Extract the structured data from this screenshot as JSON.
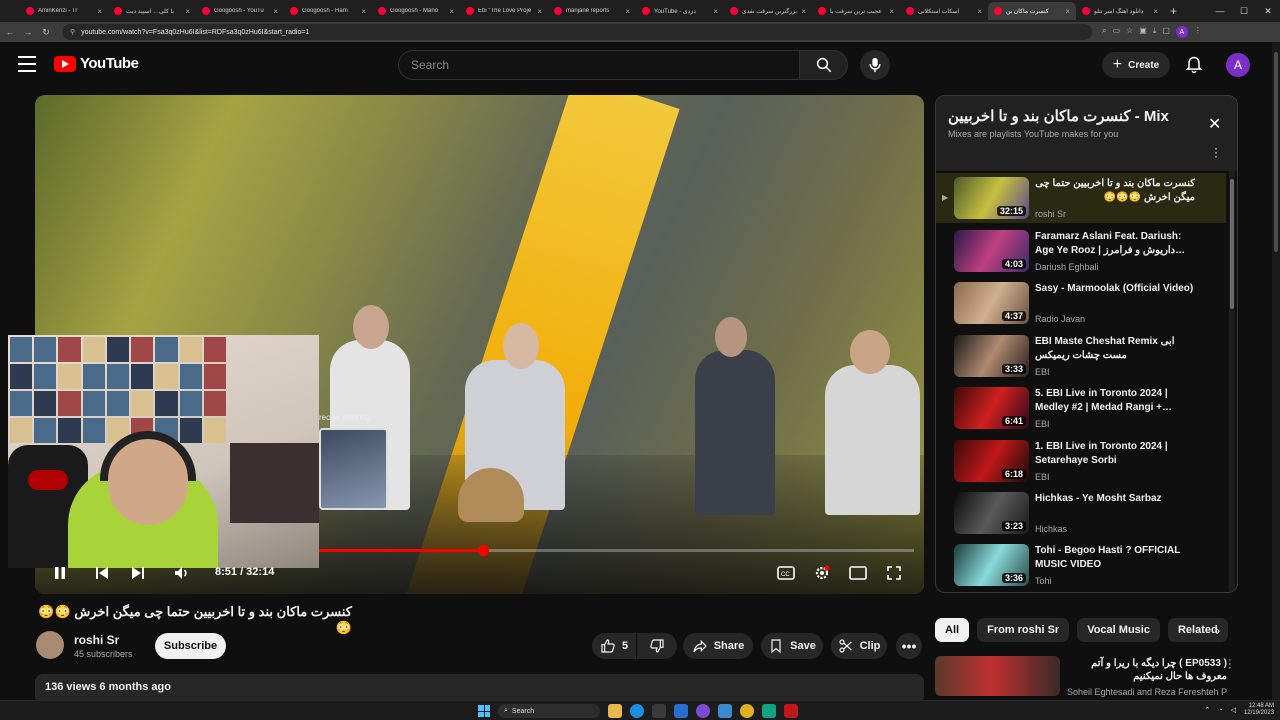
{
  "browser": {
    "tabs": [
      {
        "label": "AminKenzi - Tr"
      },
      {
        "label": "با کلی… اسپید دیت"
      },
      {
        "label": "Googoosh - YouTu"
      },
      {
        "label": "Googoosh - Ham"
      },
      {
        "label": "Googoosh - Mano"
      },
      {
        "label": "Ebi \"The Love Proje"
      },
      {
        "label": "manjane reports"
      },
      {
        "label": "YouTube - دزدی"
      },
      {
        "label": "بزرگترین سرقت نقدی"
      },
      {
        "label": "عجیب ترین سرقت با"
      },
      {
        "label": "اسکات استکلاتی"
      },
      {
        "label": "کنسرت ماکان بن"
      },
      {
        "label": "دانلود آهنگ امیر تتلو"
      }
    ],
    "url": "youtube.com/watch?v=Fsa3q0zHu6I&list=RDFsa3q0zHu6I&start_radio=1"
  },
  "header": {
    "logo_text": "YouTube",
    "search_placeholder": "Search",
    "create_label": "Create",
    "avatar_letter": "A"
  },
  "player": {
    "time": "8:51 / 32:14",
    "progress_fraction": 0.275,
    "seek_label": "recise seeking"
  },
  "video": {
    "title": "کنسرت ماکان بند و تا اخربیین حتما چی میگن اخرش 😳😳😳",
    "channel": "roshi Sr",
    "subscribers": "45 subscribers",
    "subscribe_label": "Subscribe",
    "likes": "5",
    "share_label": "Share",
    "save_label": "Save",
    "clip_label": "Clip",
    "meta": "136 views  6 months ago"
  },
  "mix": {
    "title": "کنسرت ماکان بند و تا اخربیین - Mix",
    "subtitle": "Mixes are playlists YouTube makes for you",
    "items": [
      {
        "title": "کنسرت ماکان بند و تا اخربیین حتما چی میگن اخرش 😳😳😳",
        "channel": "roshi Sr",
        "duration": "32:15"
      },
      {
        "title": "Faramarz Aslani Feat. Dariush: Age Ye Rooz | داریوش و فرامرز…",
        "channel": "Dariush Eghbali",
        "duration": "4:03"
      },
      {
        "title": "Sasy - Marmoolak (Official Video)",
        "channel": "Radio Javan",
        "duration": "4:37"
      },
      {
        "title": "EBI Maste Cheshat Remix ابی مست چشات ریمیکس",
        "channel": "EBI",
        "duration": "3:33"
      },
      {
        "title": "5. EBI Live in Toronto 2024 | Medley #2 | Medad Rangi +…",
        "channel": "EBI",
        "duration": "6:41"
      },
      {
        "title": "1. EBI Live in Toronto 2024 | Setarehaye Sorbi",
        "channel": "EBI",
        "duration": "6:18"
      },
      {
        "title": "Hichkas - Ye Mosht Sarbaz",
        "channel": "Hichkas",
        "duration": "3:23"
      },
      {
        "title": "Tohi - Begoo Hasti ? OFFICIAL MUSIC VIDEO",
        "channel": "Tohi",
        "duration": "3:36"
      }
    ]
  },
  "chips": [
    "All",
    "From roshi Sr",
    "Vocal Music",
    "Related"
  ],
  "recommendation": {
    "title": "( EP0533 ) چرا دیگه با ریرا و آتم معروف ها حال نمیکنیم",
    "channel": "Soheil Eghtesadi and Reza Fereshteh Pl..."
  },
  "taskbar": {
    "search_label": "Search",
    "time": "12:48 AM",
    "date": "12/19/2023"
  },
  "colors": {
    "background": "#0f0f0f",
    "accent_red": "#ff0000",
    "avatar": "#7b2fc9"
  }
}
